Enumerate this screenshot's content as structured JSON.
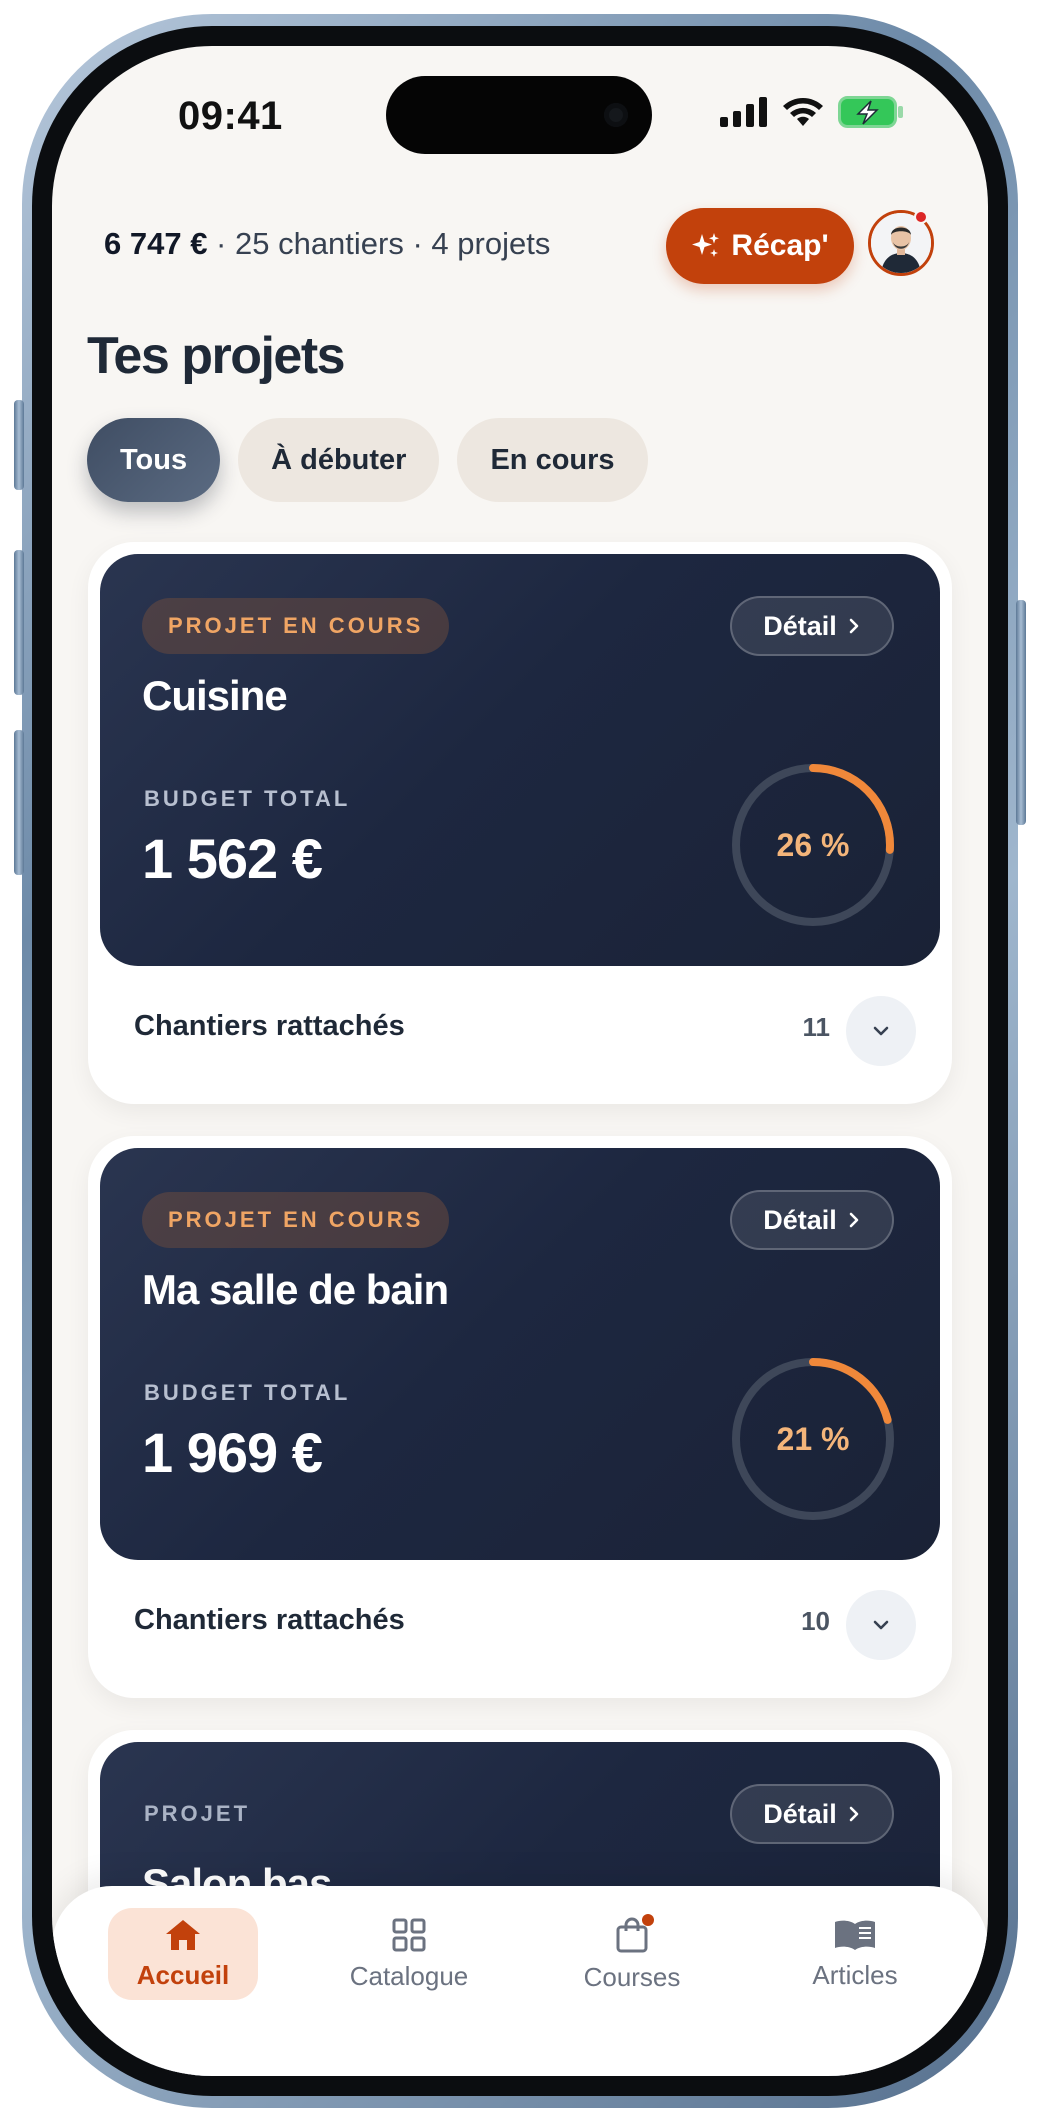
{
  "status_bar": {
    "time": "09:41"
  },
  "header": {
    "total_amount": "6 747 €",
    "summary_rest": " · 25 chantiers · 4 projets",
    "recap_label": "Récap'"
  },
  "page": {
    "title": "Tes projets"
  },
  "filters": [
    {
      "label": "Tous",
      "active": true
    },
    {
      "label": "À débuter",
      "active": false
    },
    {
      "label": "En cours",
      "active": false
    }
  ],
  "projects": [
    {
      "status": "PROJET EN COURS",
      "name": "Cuisine",
      "budget_label": "BUDGET TOTAL",
      "budget": "1 562 €",
      "progress_label": "26 %",
      "progress": 0.26,
      "detail_label": "Détail",
      "footer_label": "Chantiers rattachés",
      "count": "11"
    },
    {
      "status": "PROJET EN COURS",
      "name": "Ma salle de bain",
      "budget_label": "BUDGET TOTAL",
      "budget": "1 969 €",
      "progress_label": "21 %",
      "progress": 0.21,
      "detail_label": "Détail",
      "footer_label": "Chantiers rattachés",
      "count": "10"
    },
    {
      "status": "PROJET",
      "name": "Salon bas",
      "detail_label": "Détail"
    }
  ],
  "tabbar": [
    {
      "label": "Accueil",
      "icon": "home-icon",
      "active": true
    },
    {
      "label": "Catalogue",
      "icon": "grid-icon",
      "active": false
    },
    {
      "label": "Courses",
      "icon": "shopping-bag-icon",
      "active": false
    },
    {
      "label": "Articles",
      "icon": "book-icon",
      "active": false
    }
  ],
  "colors": {
    "accent": "#c2410c",
    "card_dark": "#1d2740",
    "ring": "#f0883a",
    "background": "#f8f6f3"
  }
}
